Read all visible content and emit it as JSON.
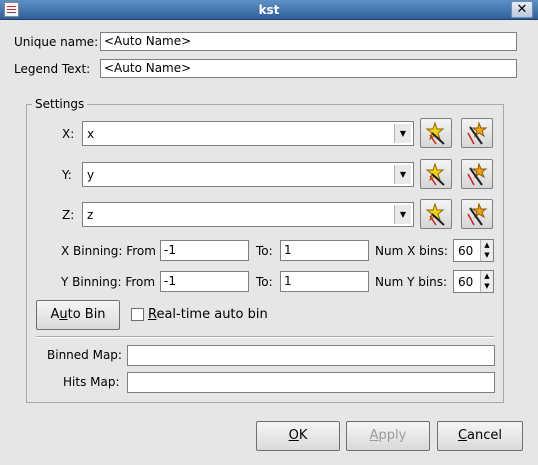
{
  "window": {
    "title": "kst"
  },
  "unique_name": {
    "label": "Unique name:",
    "value": "<Auto Name>"
  },
  "legend_text": {
    "label": "Legend Text:",
    "value": "<Auto Name>"
  },
  "settings": {
    "group_title": "Settings",
    "x": {
      "label": "X:",
      "value": "x"
    },
    "y": {
      "label": "Y:",
      "value": "y"
    },
    "z": {
      "label": "Z:",
      "value": "z"
    },
    "x_binning": {
      "label": "X Binning: From",
      "from": "-1",
      "to_label": "To:",
      "to": "1",
      "bins_label": "Num X bins:",
      "bins": "60"
    },
    "y_binning": {
      "label": "Y Binning: From",
      "from": "-1",
      "to_label": "To:",
      "to": "1",
      "bins_label": "Num Y bins:",
      "bins": "60"
    },
    "auto_bin": {
      "pre": "A",
      "u": "u",
      "post": "to Bin"
    },
    "realtime": {
      "pre": "",
      "u": "R",
      "post": "eal-time auto bin",
      "checked": false
    },
    "binned_map": {
      "label": "Binned Map:",
      "value": ""
    },
    "hits_map": {
      "label": "Hits Map:",
      "value": ""
    }
  },
  "buttons": {
    "ok": {
      "pre": "",
      "u": "O",
      "post": "K"
    },
    "apply": {
      "pre": "",
      "u": "A",
      "post": "pply",
      "enabled": false
    },
    "cancel": {
      "pre": "",
      "u": "C",
      "post": "ancel"
    }
  },
  "icons": {
    "close": "close-icon",
    "new_vector": "new-vector-wand-icon",
    "edit_vector": "edit-vector-wand-icon",
    "combo_arrow": "chevron-down-icon"
  }
}
